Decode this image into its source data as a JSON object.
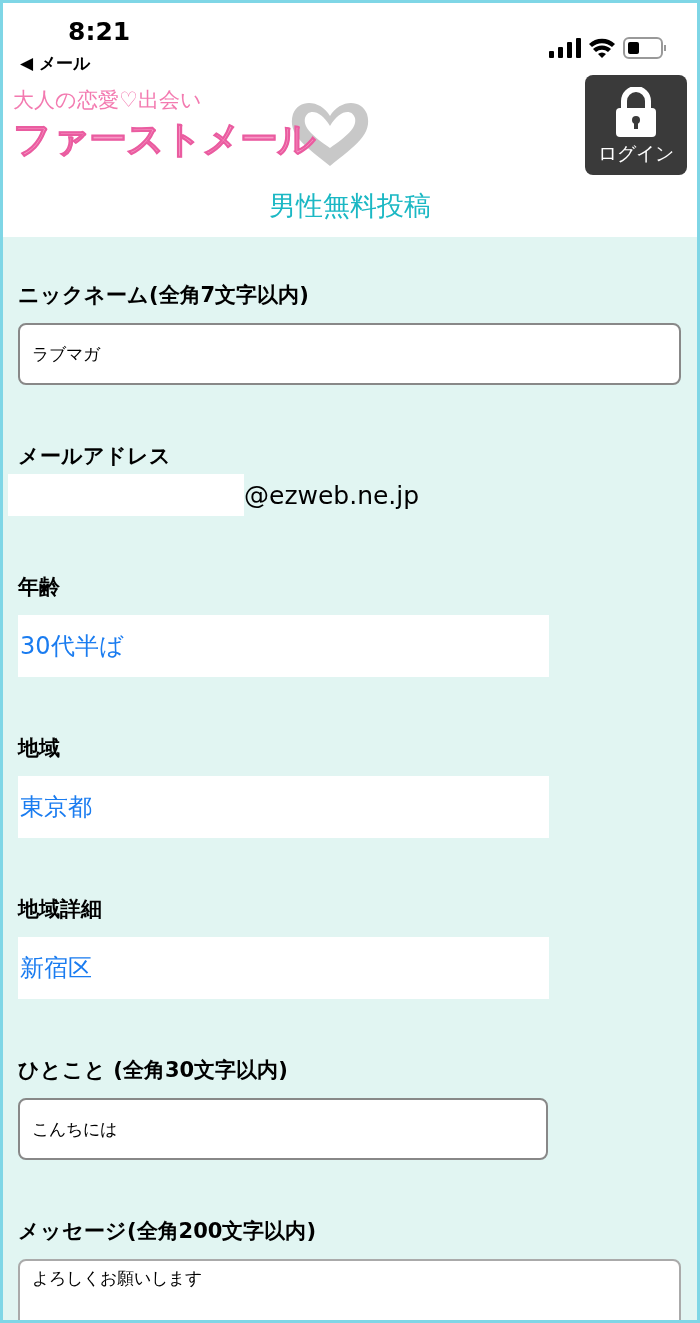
{
  "status_bar": {
    "time": "8:21",
    "back": "◀ メール"
  },
  "header": {
    "tagline": "大人の恋愛♡出会い",
    "logo": "ファーストメール",
    "login": "ログイン"
  },
  "title": "男性無料投稿",
  "fields": [
    {
      "kind": "text",
      "label": "ニックネーム(全角7文字以内)",
      "value": "ラブマガ",
      "wide": true
    },
    {
      "kind": "email",
      "label": "メールアドレス",
      "suffix": "@ezweb.ne.jp"
    },
    {
      "kind": "select",
      "label": "年齢",
      "value": "30代半ば"
    },
    {
      "kind": "select",
      "label": "地域",
      "value": "東京都"
    },
    {
      "kind": "select",
      "label": "地域詳細",
      "value": "新宿区"
    },
    {
      "kind": "text",
      "label": "ひとこと (全角30文字以内)",
      "value": "こんちには",
      "wide": false
    },
    {
      "kind": "textarea",
      "label": "メッセージ(全角200文字以内)",
      "value": "よろしくお願いします"
    }
  ]
}
